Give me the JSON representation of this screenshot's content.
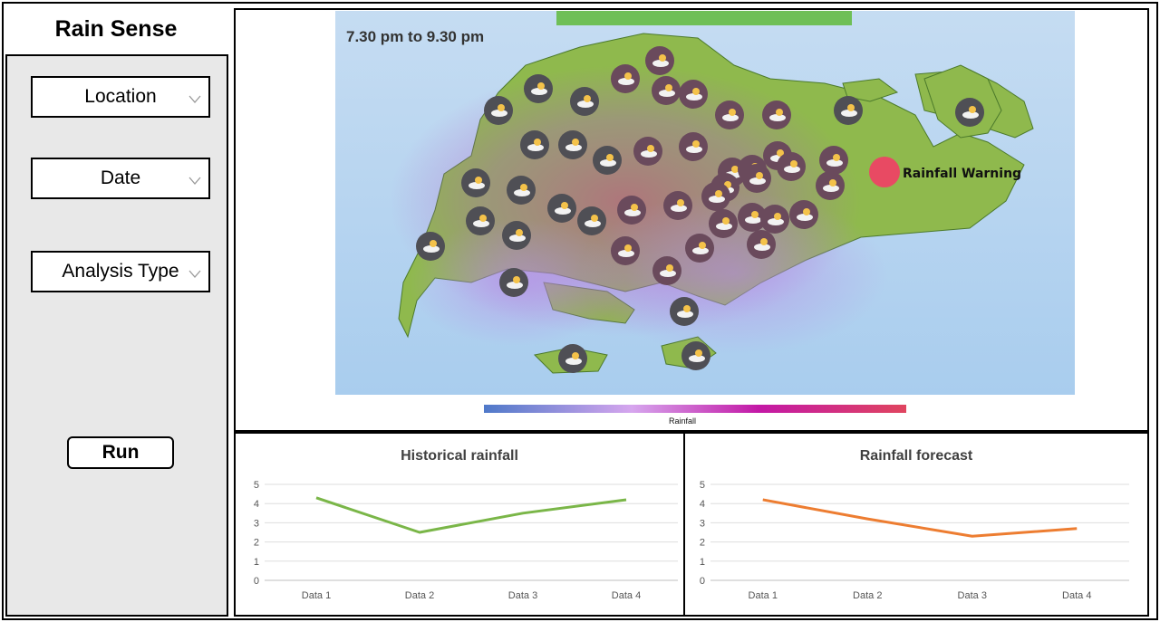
{
  "app": {
    "title": "Rain Sense"
  },
  "sidebar": {
    "location_label": "Location",
    "date_label": "Date",
    "analysis_label": "Analysis Type",
    "run_label": "Run"
  },
  "map": {
    "time_range": "7.30 pm to 9.30 pm",
    "warning_label": "Rainfall Warning",
    "legend_label": "Rainfall",
    "colors": {
      "land": "#8db84a",
      "water": "#b6d4f1",
      "warning": "#e84a63",
      "topbar": "#6fbf57"
    }
  },
  "chart_data": [
    {
      "type": "line",
      "title": "Historical rainfall",
      "categories": [
        "Data 1",
        "Data 2",
        "Data 3",
        "Data 4"
      ],
      "series": [
        {
          "values": [
            4.3,
            2.5,
            3.5,
            4.2
          ],
          "color": "#7ab648"
        }
      ],
      "ylim": [
        0,
        5
      ],
      "yticks": [
        0,
        1,
        2,
        3,
        4,
        5
      ],
      "grid": true
    },
    {
      "type": "line",
      "title": "Rainfall forecast",
      "categories": [
        "Data 1",
        "Data 2",
        "Data 3",
        "Data 4"
      ],
      "series": [
        {
          "values": [
            4.2,
            3.2,
            2.3,
            2.7
          ],
          "color": "#ed7d31"
        }
      ],
      "ylim": [
        0,
        5
      ],
      "yticks": [
        0,
        1,
        2,
        3,
        4,
        5
      ],
      "grid": true
    }
  ]
}
